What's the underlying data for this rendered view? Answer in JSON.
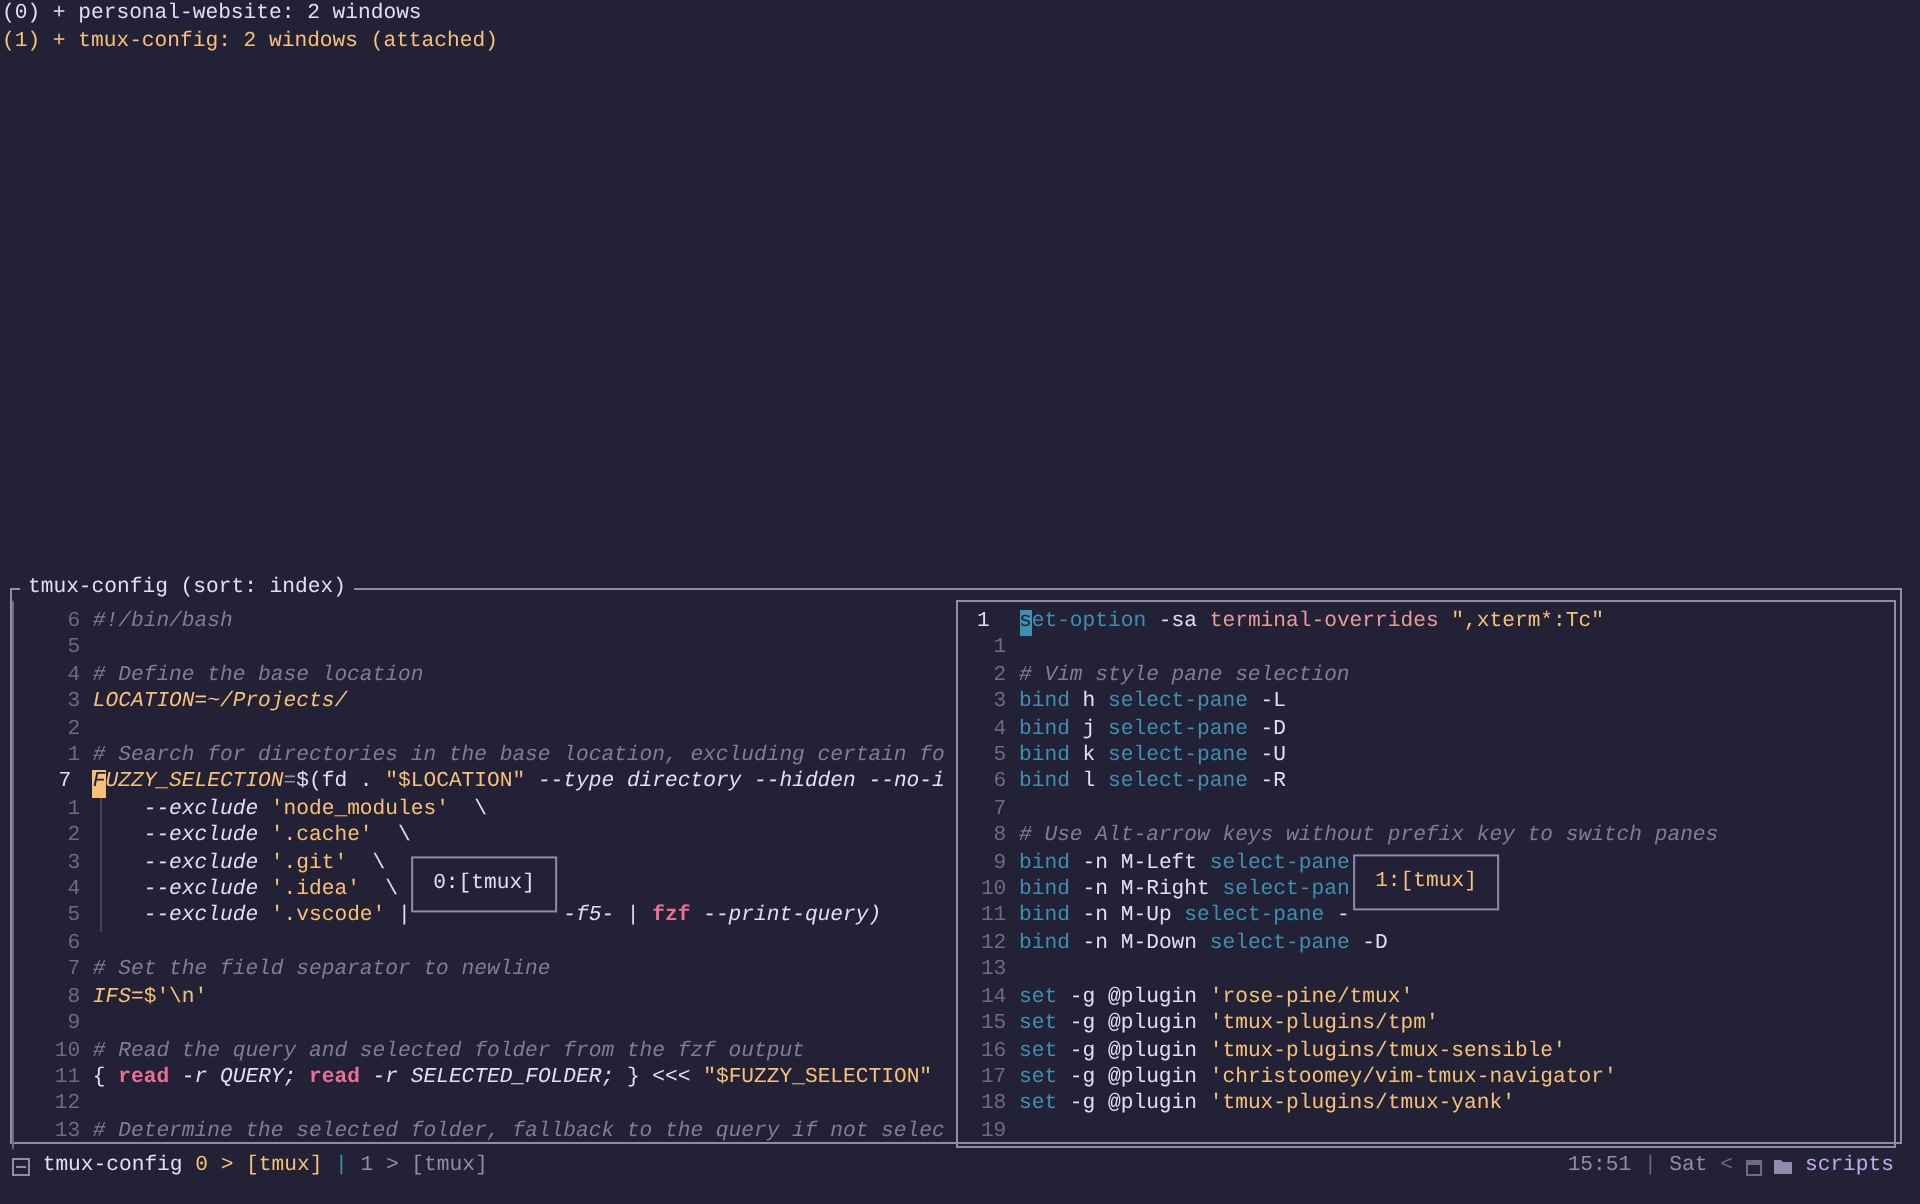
{
  "sessions": [
    {
      "text": "(0) + personal-website: 2 windows",
      "selected": false
    },
    {
      "text": "(1) + tmux-config: 2 windows (attached)",
      "selected": true
    }
  ],
  "preview": {
    "title": "tmux-config (sort: index)",
    "panes": [
      {
        "active": false,
        "popup": {
          "label": "0:[tmux]",
          "selected": false
        },
        "lines": [
          {
            "num": "6",
            "current": false,
            "guide": false,
            "segments": [
              {
                "kind": "comment",
                "text": "#!/bin/bash"
              }
            ]
          },
          {
            "num": "5",
            "current": false,
            "guide": false
          },
          {
            "num": "4",
            "current": false,
            "guide": false,
            "segments": [
              {
                "kind": "comment",
                "text": "# Define the base location"
              }
            ]
          },
          {
            "num": "3",
            "current": false,
            "guide": false,
            "segments": [
              {
                "kind": "var",
                "text": "LOCATION=~/Projects/"
              }
            ]
          },
          {
            "num": "2",
            "current": false,
            "guide": false
          },
          {
            "num": "1",
            "current": false,
            "guide": false,
            "segments": [
              {
                "kind": "comment",
                "text": "# Search for directories in the base location, excluding certain fo"
              }
            ]
          },
          {
            "num": "7",
            "current": true,
            "guide": false,
            "segments": [
              {
                "kind": "var",
                "text": "F",
                "cursor": true
              },
              {
                "kind": "var",
                "text": "UZZY_SELECTION"
              },
              {
                "kind": "op",
                "text": "="
              },
              {
                "kind": "plain",
                "text": "$(fd . "
              },
              {
                "kind": "str",
                "text": "\"$LOCATION\""
              },
              {
                "kind": "flag",
                "text": " --type directory --hidden --no-i"
              }
            ]
          },
          {
            "num": "1",
            "current": false,
            "guide": true,
            "segments": [
              {
                "kind": "flag",
                "text": "    --exclude "
              },
              {
                "kind": "str",
                "text": "'node_modules'"
              },
              {
                "kind": "plain",
                "text": "  \\"
              }
            ]
          },
          {
            "num": "2",
            "current": false,
            "guide": true,
            "segments": [
              {
                "kind": "flag",
                "text": "    --exclude "
              },
              {
                "kind": "str",
                "text": "'.cache'"
              },
              {
                "kind": "plain",
                "text": "  \\"
              }
            ]
          },
          {
            "num": "3",
            "current": false,
            "guide": true,
            "segments": [
              {
                "kind": "flag",
                "text": "    --exclude "
              },
              {
                "kind": "str",
                "text": "'.git'"
              },
              {
                "kind": "plain",
                "text": "  \\"
              }
            ]
          },
          {
            "num": "4",
            "current": false,
            "guide": true,
            "segments": [
              {
                "kind": "flag",
                "text": "    --exclude "
              },
              {
                "kind": "str",
                "text": "'.idea'"
              },
              {
                "kind": "plain",
                "text": "  \\"
              }
            ]
          },
          {
            "num": "5",
            "current": false,
            "guide": true,
            "segments": [
              {
                "kind": "flag",
                "text": "    --exclude "
              },
              {
                "kind": "str",
                "text": "'.vscode'"
              },
              {
                "kind": "plain",
                "text": " |"
              },
              {
                "kind": "flag",
                "text": "-f5-",
                "after_popup": true
              },
              {
                "kind": "plain",
                "text": " | "
              },
              {
                "kind": "kw",
                "text": "fzf"
              },
              {
                "kind": "flag",
                "text": " --print-query)"
              }
            ]
          },
          {
            "num": "6",
            "current": false,
            "guide": false
          },
          {
            "num": "7",
            "current": false,
            "guide": false,
            "segments": [
              {
                "kind": "comment",
                "text": "# Set the field separator to newline"
              }
            ]
          },
          {
            "num": "8",
            "current": false,
            "guide": false,
            "segments": [
              {
                "kind": "var",
                "text": "IFS"
              },
              {
                "kind": "str",
                "text": "=$'\\n'"
              }
            ]
          },
          {
            "num": "9",
            "current": false,
            "guide": false
          },
          {
            "num": "10",
            "current": false,
            "guide": false,
            "segments": [
              {
                "kind": "comment",
                "text": "# Read the query and selected folder from the fzf output"
              }
            ]
          },
          {
            "num": "11",
            "current": false,
            "guide": false,
            "segments": [
              {
                "kind": "plain",
                "text": "{ "
              },
              {
                "kind": "kw",
                "text": "read"
              },
              {
                "kind": "flag",
                "text": " -r QUERY; "
              },
              {
                "kind": "kw",
                "text": "read"
              },
              {
                "kind": "flag",
                "text": " -r SELECTED_FOLDER; "
              },
              {
                "kind": "plain",
                "text": "} <<< "
              },
              {
                "kind": "str",
                "text": "\"$FUZZY_SELECTION\""
              }
            ]
          },
          {
            "num": "12",
            "current": false,
            "guide": false
          },
          {
            "num": "13",
            "current": false,
            "guide": false,
            "segments": [
              {
                "kind": "comment",
                "text": "# Determine the selected folder, fallback to the query if not selec"
              }
            ]
          }
        ]
      },
      {
        "active": true,
        "popup": {
          "label": "1:[tmux]",
          "selected": true
        },
        "lines": [
          {
            "num": "1",
            "current": true,
            "guide": false,
            "segments": [
              {
                "kind": "cmd",
                "text": "s",
                "cursor": true
              },
              {
                "kind": "cmd",
                "text": "et-option"
              },
              {
                "kind": "plain",
                "text": " -sa "
              },
              {
                "kind": "fn",
                "text": "terminal-overrides"
              },
              {
                "kind": "str",
                "text": " \",xterm*:Tc\""
              }
            ]
          },
          {
            "num": "1",
            "current": false,
            "guide": false
          },
          {
            "num": "2",
            "current": false,
            "guide": false,
            "segments": [
              {
                "kind": "comment",
                "text": "# Vim style pane selection"
              }
            ]
          },
          {
            "num": "3",
            "current": false,
            "guide": false,
            "segments": [
              {
                "kind": "cmd",
                "text": "bind"
              },
              {
                "kind": "plain",
                "text": " h "
              },
              {
                "kind": "cmd",
                "text": "select-pane"
              },
              {
                "kind": "plain",
                "text": " -L"
              }
            ]
          },
          {
            "num": "4",
            "current": false,
            "guide": false,
            "segments": [
              {
                "kind": "cmd",
                "text": "bind"
              },
              {
                "kind": "plain",
                "text": " j "
              },
              {
                "kind": "cmd",
                "text": "select-pane"
              },
              {
                "kind": "plain",
                "text": " -D"
              }
            ]
          },
          {
            "num": "5",
            "current": false,
            "guide": false,
            "segments": [
              {
                "kind": "cmd",
                "text": "bind"
              },
              {
                "kind": "plain",
                "text": " k "
              },
              {
                "kind": "cmd",
                "text": "select-pane"
              },
              {
                "kind": "plain",
                "text": " -U"
              }
            ]
          },
          {
            "num": "6",
            "current": false,
            "guide": false,
            "segments": [
              {
                "kind": "cmd",
                "text": "bind"
              },
              {
                "kind": "plain",
                "text": " l "
              },
              {
                "kind": "cmd",
                "text": "select-pane"
              },
              {
                "kind": "plain",
                "text": " -R"
              }
            ]
          },
          {
            "num": "7",
            "current": false,
            "guide": false
          },
          {
            "num": "8",
            "current": false,
            "guide": false,
            "segments": [
              {
                "kind": "comment",
                "text": "# Use Alt-arrow keys without prefix key to switch panes"
              }
            ]
          },
          {
            "num": "9",
            "current": false,
            "guide": false,
            "segments": [
              {
                "kind": "cmd",
                "text": "bind"
              },
              {
                "kind": "plain",
                "text": " -n M-Left "
              },
              {
                "kind": "cmd",
                "text": "select-pane"
              }
            ]
          },
          {
            "num": "10",
            "current": false,
            "guide": false,
            "segments": [
              {
                "kind": "cmd",
                "text": "bind"
              },
              {
                "kind": "plain",
                "text": " -n M-Right "
              },
              {
                "kind": "cmd",
                "text": "select-pan"
              }
            ]
          },
          {
            "num": "11",
            "current": false,
            "guide": false,
            "segments": [
              {
                "kind": "cmd",
                "text": "bind"
              },
              {
                "kind": "plain",
                "text": " -n M-Up "
              },
              {
                "kind": "cmd",
                "text": "select-pane"
              },
              {
                "kind": "plain",
                "text": " -"
              }
            ]
          },
          {
            "num": "12",
            "current": false,
            "guide": false,
            "segments": [
              {
                "kind": "cmd",
                "text": "bind"
              },
              {
                "kind": "plain",
                "text": " -n M-Down "
              },
              {
                "kind": "cmd",
                "text": "select-pane"
              },
              {
                "kind": "plain",
                "text": " -D"
              }
            ]
          },
          {
            "num": "13",
            "current": false,
            "guide": false
          },
          {
            "num": "14",
            "current": false,
            "guide": false,
            "segments": [
              {
                "kind": "cmd",
                "text": "set"
              },
              {
                "kind": "plain",
                "text": " -g @plugin "
              },
              {
                "kind": "str",
                "text": "'rose-pine/tmux'"
              }
            ]
          },
          {
            "num": "15",
            "current": false,
            "guide": false,
            "segments": [
              {
                "kind": "cmd",
                "text": "set"
              },
              {
                "kind": "plain",
                "text": " -g @plugin "
              },
              {
                "kind": "str",
                "text": "'tmux-plugins/tpm'"
              }
            ]
          },
          {
            "num": "16",
            "current": false,
            "guide": false,
            "segments": [
              {
                "kind": "cmd",
                "text": "set"
              },
              {
                "kind": "plain",
                "text": " -g @plugin "
              },
              {
                "kind": "str",
                "text": "'tmux-plugins/tmux-sensible'"
              }
            ]
          },
          {
            "num": "17",
            "current": false,
            "guide": false,
            "segments": [
              {
                "kind": "cmd",
                "text": "set"
              },
              {
                "kind": "plain",
                "text": " -g @plugin "
              },
              {
                "kind": "str",
                "text": "'christoomey/vim-tmux-navigator'"
              }
            ]
          },
          {
            "num": "18",
            "current": false,
            "guide": false,
            "segments": [
              {
                "kind": "cmd",
                "text": "set"
              },
              {
                "kind": "plain",
                "text": " -g @plugin "
              },
              {
                "kind": "str",
                "text": "'tmux-plugins/tmux-yank'"
              }
            ]
          },
          {
            "num": "19",
            "current": false,
            "guide": false
          }
        ]
      }
    ]
  },
  "status_bar": {
    "session": "tmux-config",
    "windows": [
      {
        "text": "0 > [tmux]",
        "selected": true
      },
      {
        "text": "1 > [tmux]",
        "selected": false
      }
    ],
    "separator": "|",
    "time": "15:51",
    "time_separator": "|",
    "day": "Sat",
    "arrow": "<",
    "folder": "scripts"
  }
}
